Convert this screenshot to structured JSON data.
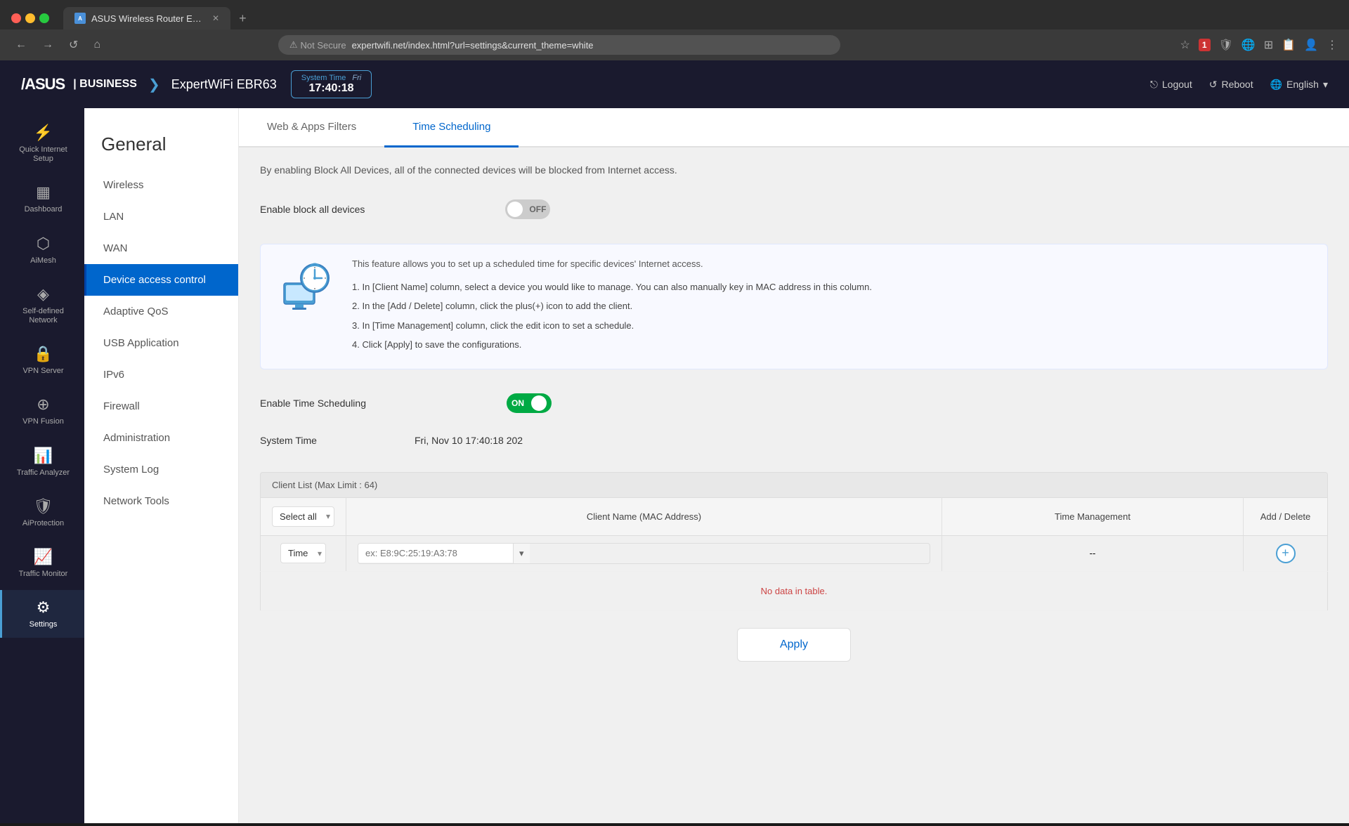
{
  "browser": {
    "tab_title": "ASUS Wireless Router Exper...",
    "favicon_color": "#4a90d9",
    "not_secure_label": "Not Secure",
    "url": "expertwifi.net/index.html?url=settings&current_theme=white",
    "nav_back": "←",
    "nav_forward": "→",
    "nav_refresh": "↺",
    "nav_home": "⌂",
    "new_tab": "+"
  },
  "header": {
    "logo": "/ASUS",
    "business": "| BUSINESS",
    "chevron": "❯",
    "product": "ExpertWiFi EBR63",
    "system_time_label": "System Time",
    "system_time_day": "Fri",
    "system_time_value": "17:40:18",
    "logout_label": "Logout",
    "reboot_label": "Reboot",
    "language": "English",
    "lang_chevron": "▾",
    "globe_icon": "🌐",
    "logout_icon": "⎋",
    "reboot_icon": "↺"
  },
  "sidebar": {
    "items": [
      {
        "id": "quick-internet-setup",
        "icon": "⚡",
        "label": "Quick Internet\nSetup"
      },
      {
        "id": "dashboard",
        "icon": "▦",
        "label": "Dashboard"
      },
      {
        "id": "aimesh",
        "icon": "⬡",
        "label": "AiMesh"
      },
      {
        "id": "self-defined-network",
        "icon": "◈",
        "label": "Self-defined\nNetwork"
      },
      {
        "id": "vpn-server",
        "icon": "🔒",
        "label": "VPN Server"
      },
      {
        "id": "vpn-fusion",
        "icon": "⊕",
        "label": "VPN Fusion"
      },
      {
        "id": "traffic-analyzer",
        "icon": "📊",
        "label": "Traffic Analyzer"
      },
      {
        "id": "aiprotection",
        "icon": "🛡",
        "label": "AiProtection"
      },
      {
        "id": "traffic-monitor",
        "icon": "📈",
        "label": "Traffic Monitor"
      },
      {
        "id": "settings",
        "icon": "⚙",
        "label": "Settings"
      }
    ]
  },
  "general_page": {
    "title": "General",
    "nav_items": [
      {
        "id": "wireless",
        "label": "Wireless"
      },
      {
        "id": "lan",
        "label": "LAN"
      },
      {
        "id": "wan",
        "label": "WAN"
      },
      {
        "id": "device-access-control",
        "label": "Device access control",
        "active": true
      },
      {
        "id": "adaptive-qos",
        "label": "Adaptive QoS"
      },
      {
        "id": "usb-application",
        "label": "USB Application"
      },
      {
        "id": "ipv6",
        "label": "IPv6"
      },
      {
        "id": "firewall",
        "label": "Firewall"
      },
      {
        "id": "administration",
        "label": "Administration"
      },
      {
        "id": "system-log",
        "label": "System Log"
      },
      {
        "id": "network-tools",
        "label": "Network Tools"
      }
    ]
  },
  "tabs": [
    {
      "id": "web-apps-filters",
      "label": "Web & Apps Filters",
      "active": false
    },
    {
      "id": "time-scheduling",
      "label": "Time Scheduling",
      "active": true
    }
  ],
  "time_scheduling": {
    "block_description": "By enabling Block All Devices, all of the connected devices will be blocked from Internet access.",
    "block_label": "Enable block all devices",
    "block_toggle": "OFF",
    "info_description": "This feature allows you to set up a scheduled time for specific devices' Internet access.",
    "info_steps": [
      "1. In [Client Name] column, select a device you would like to manage. You can also manually key in MAC address in this column.",
      "2. In the [Add / Delete] column, click the plus(+) icon to add the client.",
      "3. In [Time Management] column, click the edit icon to set a schedule.",
      "4. Click [Apply] to save the configurations."
    ],
    "enable_scheduling_label": "Enable Time Scheduling",
    "enable_scheduling_toggle": "ON",
    "system_time_label": "System Time",
    "system_time_value": "Fri, Nov 10 17:40:18 202",
    "client_list_header": "Client List (Max Limit : 64)",
    "table_headers": {
      "select": "Select all",
      "client_name": "Client Name (MAC Address)",
      "time_management": "Time Management",
      "add_delete": "Add / Delete"
    },
    "select_all_option": "Select all",
    "row_type_option": "Time",
    "mac_placeholder": "ex: E8:9C:25:19:A3:78",
    "no_data": "No data in table.",
    "apply_label": "Apply"
  }
}
